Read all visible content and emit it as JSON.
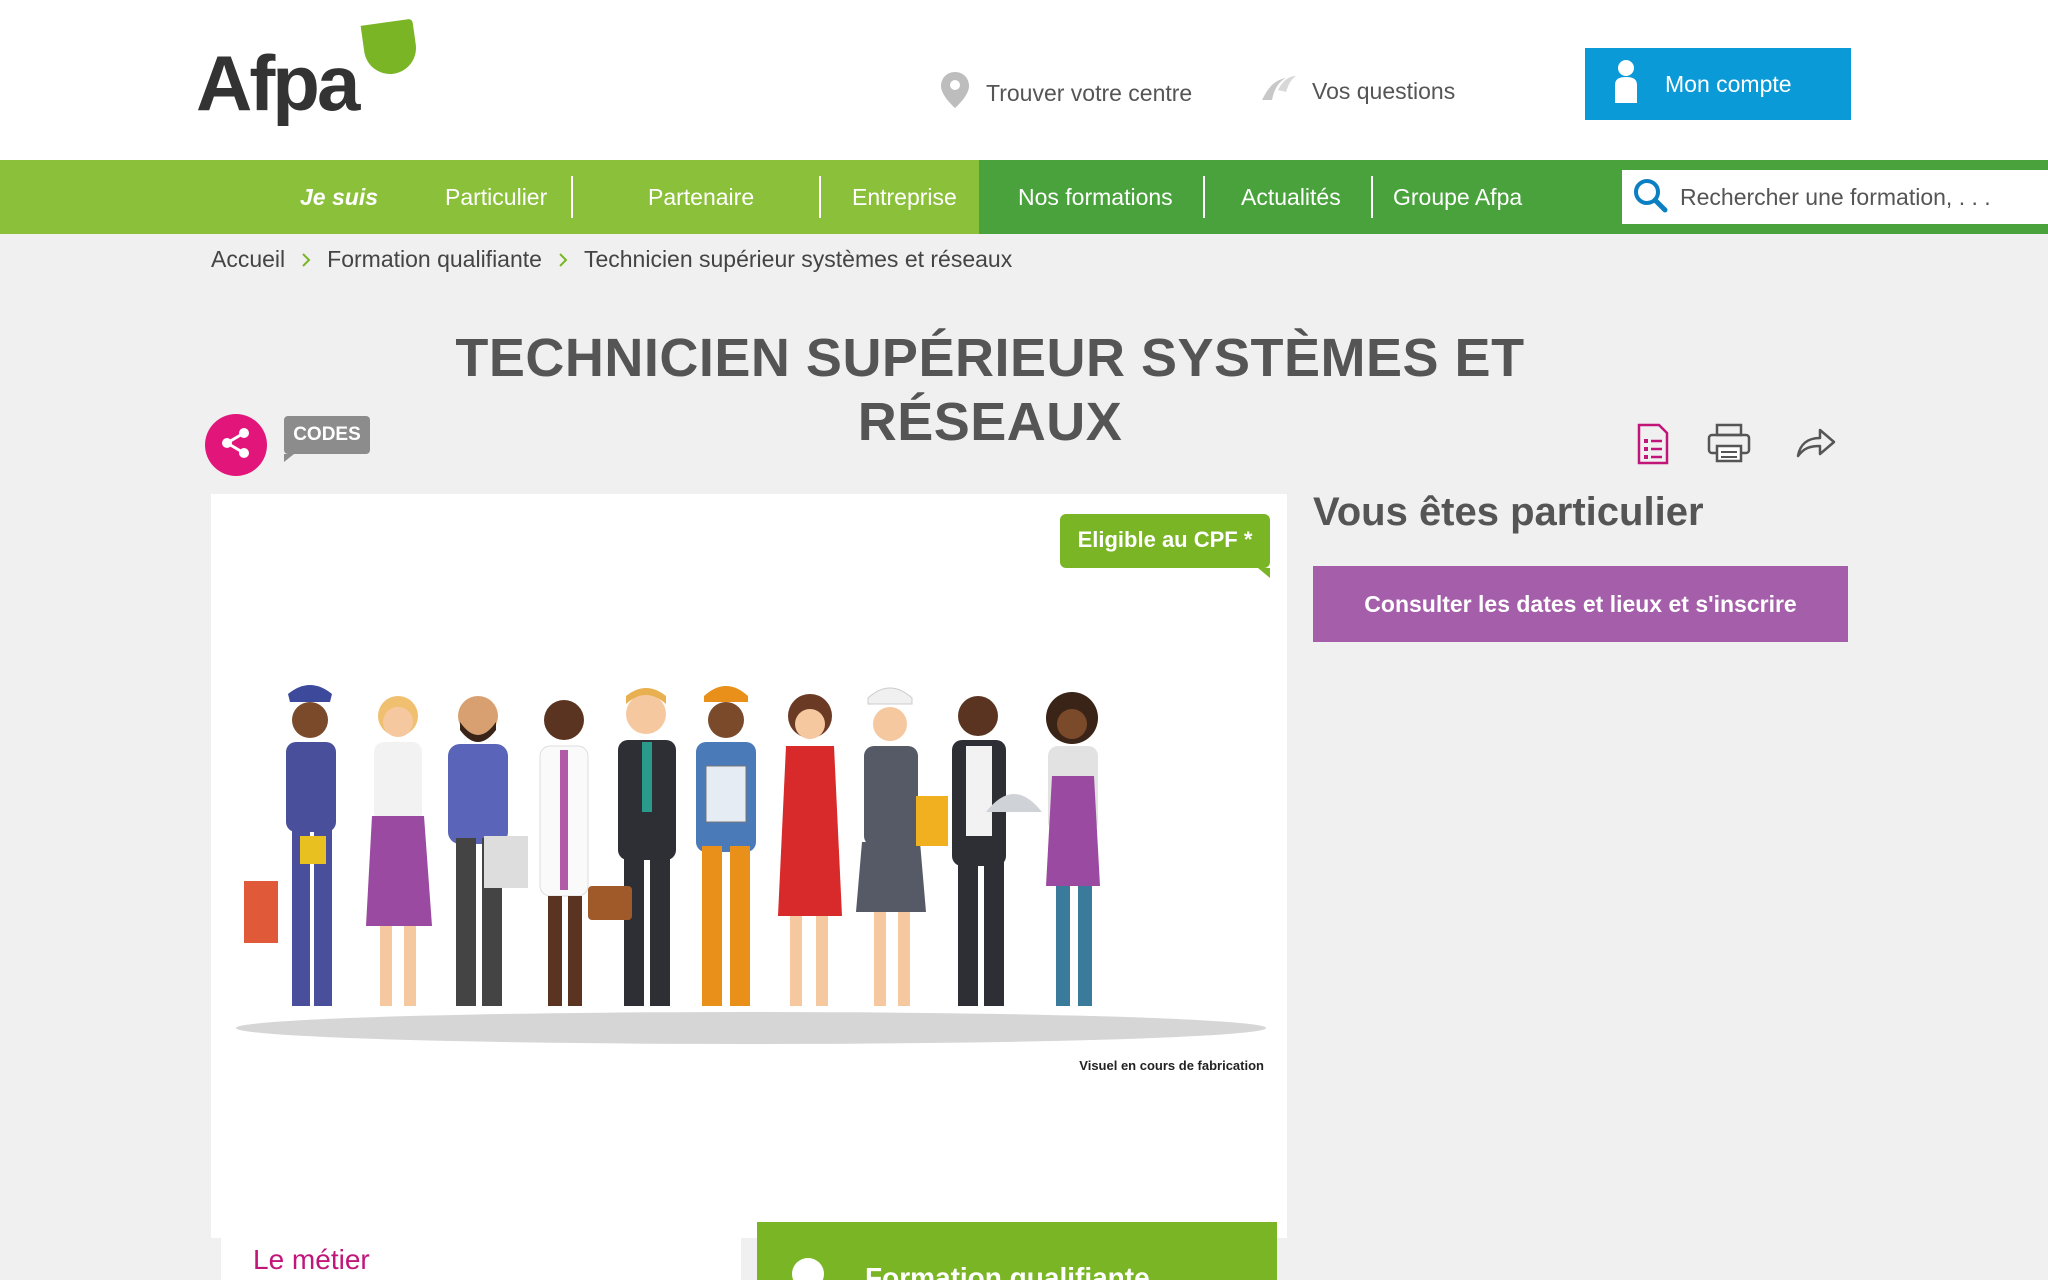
{
  "header": {
    "logo_text": "Afpa",
    "find_center": "Trouver votre centre",
    "questions": "Vos questions",
    "account": "Mon compte"
  },
  "nav": {
    "je_suis": "Je suis",
    "items": [
      "Particulier",
      "Partenaire",
      "Entreprise",
      "Nos formations",
      "Actualités",
      "Groupe Afpa"
    ],
    "search_placeholder": "Rechercher une formation, . . ."
  },
  "breadcrumb": [
    "Accueil",
    "Formation qualifiante",
    "Technicien supérieur systèmes et réseaux"
  ],
  "page": {
    "title": "TECHNICIEN SUPÉRIEUR SYSTÈMES ET RÉSEAUX",
    "codes_label": "CODES",
    "cpf_badge": "Eligible au CPF *",
    "image_caption": "Visuel en cours de fabrication"
  },
  "sidebar": {
    "heading": "Vous êtes particulier",
    "cta": "Consulter les dates et lieux et s'inscrire"
  },
  "sections": {
    "metier": "Le métier",
    "formation": "Formation qualifiante"
  },
  "colors": {
    "green_light": "#8bc03a",
    "green_dark": "#4aa23c",
    "account_blue": "#0b9ad8",
    "magenta": "#e2167a",
    "purple": "#a55eaa"
  },
  "icons": [
    "location-pin-icon",
    "chat-bubbles-icon",
    "user-icon",
    "search-icon",
    "chevron-right-icon",
    "share-icon",
    "document-list-icon",
    "printer-icon",
    "forward-arrow-icon"
  ]
}
